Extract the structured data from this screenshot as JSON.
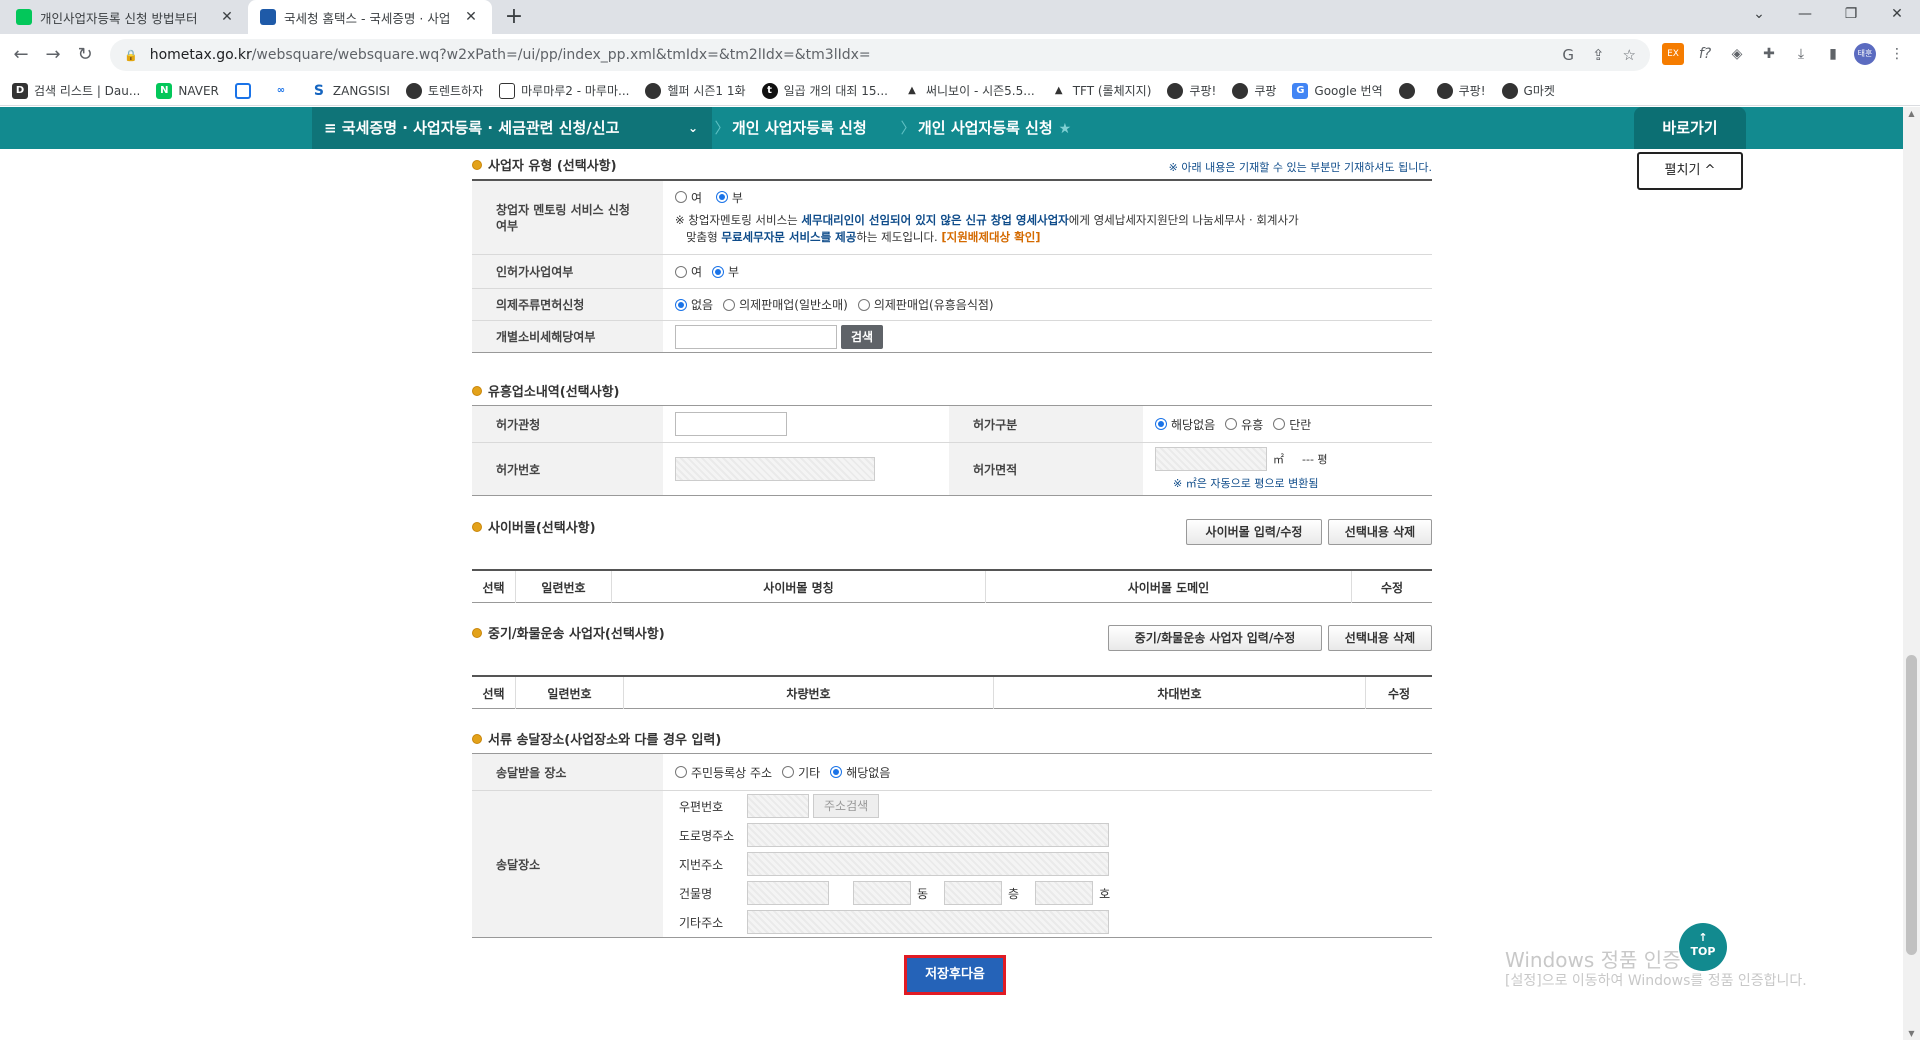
{
  "browser": {
    "tabs": [
      {
        "title": "개인사업자등록 신청 방법부터 ",
        "active": false
      },
      {
        "title": "국세청 홈택스 - 국세증명 · 사업",
        "active": true
      }
    ],
    "new_tab": "+",
    "url_domain": "hometax.go.kr",
    "url_path": "/websquare/websquare.wq?w2xPath=/ui/pp/index_pp.xml&tmIdx=&tm2lIdx=&tm3lIdx=",
    "profile": "태훈",
    "bookmarks": [
      {
        "icon": "daum",
        "label": "검색 리스트 | Dau..."
      },
      {
        "icon": "N",
        "label": "NAVER"
      },
      {
        "icon": "C",
        "label": ""
      },
      {
        "icon": "∞",
        "label": ""
      },
      {
        "icon": "S",
        "label": "ZANGSISI"
      },
      {
        "icon": "◎",
        "label": "토렌트하자"
      },
      {
        "icon": "▭",
        "label": "마루마루2 - 마루마..."
      },
      {
        "icon": "◎",
        "label": "헬퍼 시즌1 1화"
      },
      {
        "icon": "t",
        "label": "일곱 개의 대죄 15..."
      },
      {
        "icon": "▲",
        "label": "써니보이 - 시즌5.5..."
      },
      {
        "icon": "▲",
        "label": "TFT (롤체지지)"
      },
      {
        "icon": "◎",
        "label": "쿠팡!"
      },
      {
        "icon": "◎",
        "label": "쿠팡"
      },
      {
        "icon": "G",
        "label": "Google 번역"
      },
      {
        "icon": "◎",
        "label": ""
      },
      {
        "icon": "◎",
        "label": "쿠팡!"
      },
      {
        "icon": "◎",
        "label": "G마켓"
      }
    ]
  },
  "header": {
    "menu": "≡  국세증명 · 사업자등록 · 세금관련 신청/신고",
    "crumb1": "개인 사업자등록 신청",
    "crumb2": "개인 사업자등록 신청",
    "quick": "바로가기",
    "expand": "펼치기 ^"
  },
  "business_type": {
    "title": "사업자 유형 (선택사항)",
    "note": "※ 아래 내용은 기재할 수 있는 부분만 기재하셔도 됩니다.",
    "mentoring_label": "창업자 멘토링 서비스 신청여부",
    "yes": "여",
    "no": "부",
    "mentoring_desc_1": "※ 창업자멘토링 서비스는 ",
    "mentoring_desc_2": "세무대리인이 선임되어 있지 않은 신규 창업 영세사업자",
    "mentoring_desc_3": "에게 영세납세자지원단의 나눔세무사 · 회계사가",
    "mentoring_desc_4": "맞춤형 ",
    "mentoring_desc_5": "무료세무자문 서비스를 제공",
    "mentoring_desc_6": "하는 제도입니다. ",
    "mentoring_desc_7": "[지원배제대상 확인]",
    "license_label": "인허가사업여부",
    "liquor_label": "의제주류면허신청",
    "liquor_opts": [
      "없음",
      "의제판매업(일반소매)",
      "의제판매업(유흥음식점)"
    ],
    "excise_label": "개별소비세해당여부",
    "search_btn": "검색"
  },
  "entertainment": {
    "title": "유흥업소내역(선택사항)",
    "office_label": "허가관청",
    "type_label": "허가구분",
    "type_opts": [
      "해당없음",
      "유흥",
      "단란"
    ],
    "number_label": "허가번호",
    "area_label": "허가면적",
    "area_unit": "㎡",
    "pyeong": "--- 평",
    "area_note": "※ ㎡은 자동으로 평으로 변환됨"
  },
  "cybermall": {
    "title": "사이버몰(선택사항)",
    "btn_edit": "사이버몰 입력/수정",
    "btn_delete": "선택내용 삭제",
    "cols": [
      "선택",
      "일련번호",
      "사이버몰 명칭",
      "사이버몰 도메인",
      "수정"
    ]
  },
  "freight": {
    "title": "중기/화물운송 사업자(선택사항)",
    "btn_edit": "중기/화물운송 사업자 입력/수정",
    "btn_delete": "선택내용 삭제",
    "cols": [
      "선택",
      "일련번호",
      "차량번호",
      "차대번호",
      "수정"
    ]
  },
  "delivery": {
    "title": "서류 송달장소(사업장소와 다를 경우 입력)",
    "place_label": "송달받을 장소",
    "place_opts": [
      "주민등록상 주소",
      "기타",
      "해당없음"
    ],
    "addr_label": "송달장소",
    "zip": "우편번호",
    "addr_search": "주소검색",
    "road": "도로명주소",
    "lot": "지번주소",
    "building": "건물명",
    "dong": "동",
    "floor": "층",
    "ho": "호",
    "other": "기타주소"
  },
  "actions": {
    "save_next": "저장후다음",
    "top": "TOP"
  },
  "watermark": {
    "line1": "Windows 정품 인증",
    "line2": "[설정]으로 이동하여 Windows를 정품 인증합니다."
  }
}
